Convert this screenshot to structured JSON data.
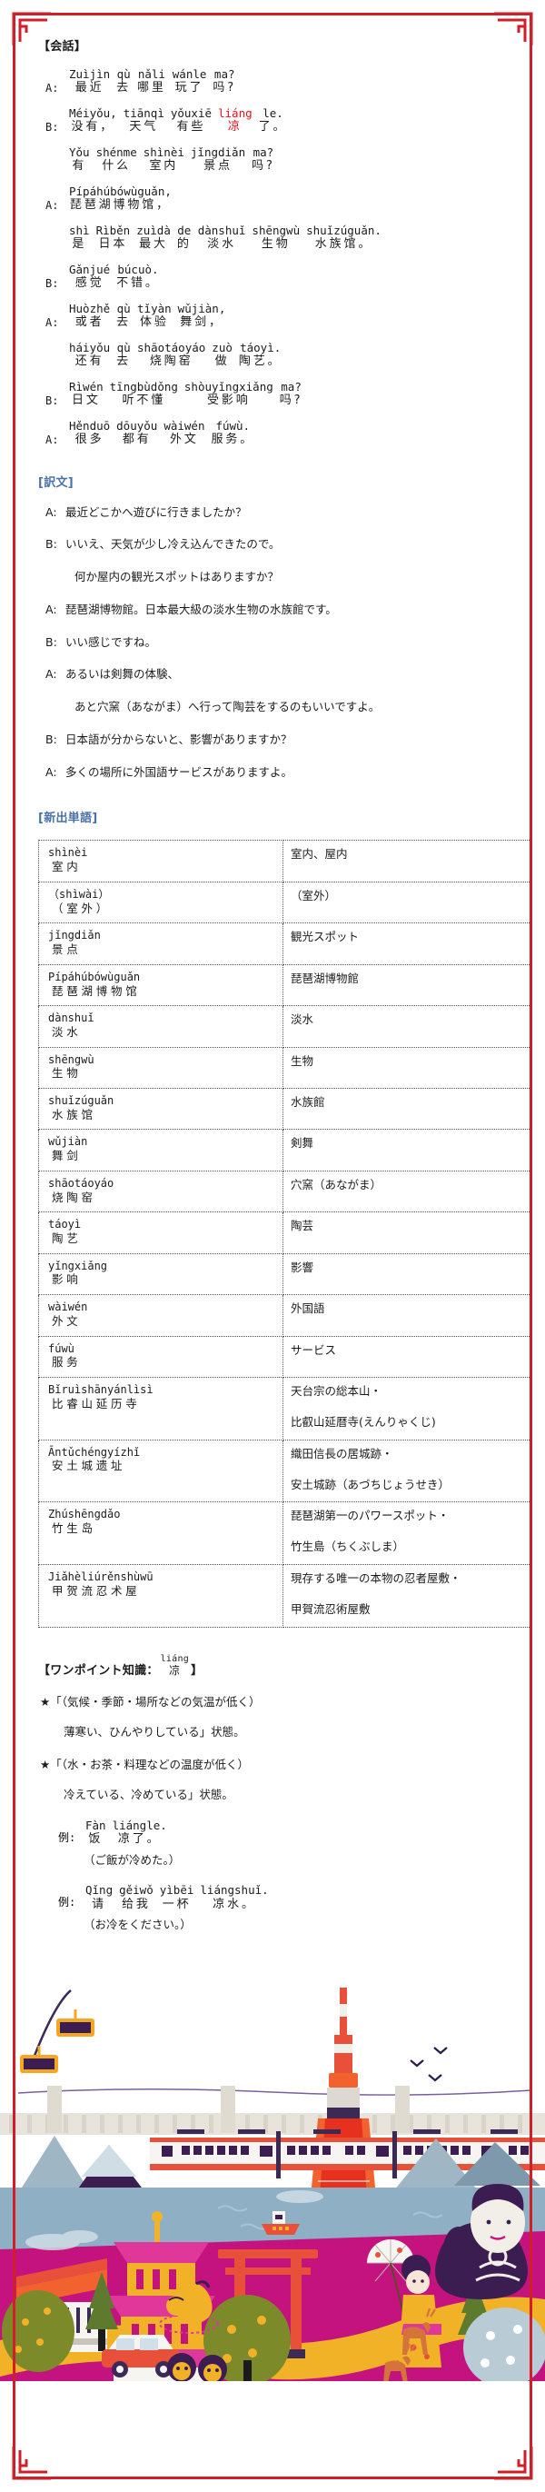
{
  "sections": {
    "dialogue_head": "【会話】",
    "translation_head": "[訳文]",
    "vocab_head": "[新出単語]",
    "onepoint_head_pre": "【ワンポイント知識：",
    "onepoint_head_post": "】",
    "onepoint_word_pinyin": "liáng",
    "onepoint_word_hanzi": "凉"
  },
  "colors": {
    "frame_red": "#d11f2a",
    "heading_blue": "#4a72a8",
    "highlight_red": "#e8101b",
    "text_black": "#1b1b1b"
  },
  "dialogue": [
    {
      "speaker": "A:",
      "tokens": [
        {
          "py": "Zuìjìn",
          "hz": "最近",
          "hl": false
        },
        {
          "py": "qù",
          "hz": "去",
          "hl": false
        },
        {
          "py": "nǎli",
          "hz": "哪里",
          "hl": false
        },
        {
          "py": "wánle",
          "hz": "玩了",
          "hl": false
        },
        {
          "py": "ma?",
          "hz": "吗?",
          "hl": false
        }
      ]
    },
    {
      "speaker": "B:",
      "tokens": [
        {
          "py": "Méiyǒu,",
          "hz": "没有，",
          "hl": false
        },
        {
          "py": "tiānqì",
          "hz": "天气",
          "hl": false
        },
        {
          "py": "yǒuxiē",
          "hz": "有些",
          "hl": false
        },
        {
          "py": "liáng",
          "hz": "凉",
          "hl": true
        },
        {
          "py": "le.",
          "hz": "了。",
          "hl": false
        }
      ]
    },
    {
      "speaker": "",
      "tokens": [
        {
          "py": "Yǒu",
          "hz": "有",
          "hl": false
        },
        {
          "py": "shénme",
          "hz": "什么",
          "hl": false
        },
        {
          "py": "shìnèi",
          "hz": "室内",
          "hl": false
        },
        {
          "py": "jǐngdiǎn",
          "hz": "景点",
          "hl": false
        },
        {
          "py": "ma?",
          "hz": "吗?",
          "hl": false
        }
      ]
    },
    {
      "speaker": "A:",
      "tokens": [
        {
          "py": "Pípáhúbówùguǎn,",
          "hz": "琵琶湖博物馆，",
          "hl": false
        }
      ]
    },
    {
      "speaker": "",
      "tokens": [
        {
          "py": "shì",
          "hz": "是",
          "hl": false
        },
        {
          "py": "Rìběn",
          "hz": "日本",
          "hl": false
        },
        {
          "py": "zuìdà",
          "hz": "最大",
          "hl": false
        },
        {
          "py": "de",
          "hz": "的",
          "hl": false
        },
        {
          "py": "dànshuǐ",
          "hz": "淡水",
          "hl": false
        },
        {
          "py": "shēngwù",
          "hz": "生物",
          "hl": false
        },
        {
          "py": "shuǐzúguǎn.",
          "hz": "水族馆。",
          "hl": false
        }
      ]
    },
    {
      "speaker": "B:",
      "tokens": [
        {
          "py": "Gǎnjué",
          "hz": "感觉",
          "hl": false
        },
        {
          "py": "búcuò.",
          "hz": "不错。",
          "hl": false
        }
      ]
    },
    {
      "speaker": "A:",
      "tokens": [
        {
          "py": "Huòzhě",
          "hz": "或者",
          "hl": false
        },
        {
          "py": "qù",
          "hz": "去",
          "hl": false
        },
        {
          "py": "tǐyàn",
          "hz": "体验",
          "hl": false
        },
        {
          "py": "wǔjiàn,",
          "hz": "舞剑，",
          "hl": false
        }
      ]
    },
    {
      "speaker": "",
      "tokens": [
        {
          "py": "háiyǒu",
          "hz": "还有",
          "hl": false
        },
        {
          "py": "qù",
          "hz": "去",
          "hl": false
        },
        {
          "py": "shāotáoyáo",
          "hz": "烧陶窑",
          "hl": false
        },
        {
          "py": "zuò",
          "hz": "做",
          "hl": false
        },
        {
          "py": "táoyì.",
          "hz": "陶艺。",
          "hl": false
        }
      ]
    },
    {
      "speaker": "B:",
      "tokens": [
        {
          "py": "Rìwén",
          "hz": "日文",
          "hl": false
        },
        {
          "py": "tīngbùdǒng",
          "hz": "听不懂",
          "hl": false
        },
        {
          "py": "shòuyǐngxiǎng",
          "hz": "受影响",
          "hl": false
        },
        {
          "py": "ma?",
          "hz": "吗?",
          "hl": false
        }
      ]
    },
    {
      "speaker": "A:",
      "tokens": [
        {
          "py": "Hěnduō",
          "hz": "很多",
          "hl": false
        },
        {
          "py": "dōuyǒu",
          "hz": "都有",
          "hl": false
        },
        {
          "py": "wàiwén",
          "hz": "外文",
          "hl": false
        },
        {
          "py": "fúwù.",
          "hz": "服务。",
          "hl": false
        }
      ]
    }
  ],
  "translation": [
    {
      "speaker": "A:",
      "text": "最近どこかへ遊びに行きましたか？",
      "indent": false
    },
    {
      "speaker": "B:",
      "text": "いいえ、天気が少し冷え込んできたので。",
      "indent": false
    },
    {
      "speaker": "",
      "text": "何か屋内の観光スポットはありますか？",
      "indent": true
    },
    {
      "speaker": "A:",
      "text": "琵琶湖博物館。日本最大級の淡水生物の水族館です。",
      "indent": false
    },
    {
      "speaker": "B:",
      "text": "いい感じですね。",
      "indent": false
    },
    {
      "speaker": "A:",
      "text": "あるいは剣舞の体験、",
      "indent": false
    },
    {
      "speaker": "",
      "text": "あと穴窯（あながま）へ行って陶芸をするのもいいですよ。",
      "indent": true
    },
    {
      "speaker": "B:",
      "text": "日本語が分からないと、影響がありますか？",
      "indent": false
    },
    {
      "speaker": "A:",
      "text": "多くの場所に外国語サービスがありますよ。",
      "indent": false
    }
  ],
  "vocab": [
    {
      "py": "shìnèi",
      "hz": "室内",
      "py2": "",
      "hz2": "",
      "meaning": [
        "室内、屋内"
      ]
    },
    {
      "py": "（shìwài）",
      "hz": "（室外）",
      "py2": "",
      "hz2": "",
      "meaning": [
        "（室外）"
      ],
      "paren": true
    },
    {
      "py": "jǐngdiǎn",
      "hz": "景点",
      "meaning": [
        "観光スポット"
      ]
    },
    {
      "py": "Pípáhúbówùguǎn",
      "hz": "琵琶湖博物馆",
      "meaning": [
        "琵琶湖博物館"
      ]
    },
    {
      "py": "dànshuǐ",
      "hz": "淡水",
      "meaning": [
        "淡水"
      ]
    },
    {
      "py": "shēngwù",
      "hz": "生物",
      "meaning": [
        "生物"
      ]
    },
    {
      "py": "shuǐzúguǎn",
      "hz": "水族馆",
      "meaning": [
        "水族館"
      ]
    },
    {
      "py": "wǔjiàn",
      "hz": "舞剑",
      "meaning": [
        "剣舞"
      ]
    },
    {
      "py": "shāotáoyáo",
      "hz": "烧陶窑",
      "meaning": [
        "穴窯（あながま）"
      ]
    },
    {
      "py": "táoyì",
      "hz": "陶艺",
      "meaning": [
        "陶芸"
      ]
    },
    {
      "py": "yǐngxiǎng",
      "hz": "影响",
      "meaning": [
        "影響"
      ]
    },
    {
      "py": "wàiwén",
      "hz": "外文",
      "meaning": [
        "外国語"
      ]
    },
    {
      "py": "fúwù",
      "hz": "服务",
      "meaning": [
        "サービス"
      ]
    },
    {
      "py": "Bǐruìshānyánlìsì",
      "hz": "比睿山延历寺",
      "meaning": [
        "天台宗の総本山・",
        "比叡山延暦寺(えんりゃくじ)"
      ]
    },
    {
      "py": "Āntǔchéngyízhǐ",
      "hz": "安土城遗址",
      "meaning": [
        "織田信長の居城跡・",
        "安土城跡（あづちじょうせき）"
      ]
    },
    {
      "py": "Zhúshēngdǎo",
      "hz": "竹生岛",
      "meaning": [
        "琵琶湖第一のパワースポット・",
        "竹生島（ちくぶしま）"
      ]
    },
    {
      "py": "Jiǎhèliúrěnshùwū",
      "hz": "甲贺流忍术屋",
      "meaning": [
        "現存する唯一の本物の忍者屋敷・",
        "甲賀流忍術屋敷"
      ]
    }
  ],
  "onepoint": {
    "star1": "★「（気候・季節・場所などの気温が低く）",
    "star1_sub": "薄寒い、ひんやりしている」状態。",
    "star2": "★「（水・お茶・料理などの温度が低く）",
    "star2_sub": "冷えている、冷めている」状態。",
    "examples": [
      {
        "label": "例:",
        "tokens": [
          {
            "py": "Fàn",
            "hz": "饭"
          },
          {
            "py": "liángle.",
            "hz": "凉了。"
          }
        ],
        "jp": "（ご飯が冷めた。）"
      },
      {
        "label": "例:",
        "tokens": [
          {
            "py": "Qǐng",
            "hz": "请"
          },
          {
            "py": "gěiwǒ",
            "hz": "给我"
          },
          {
            "py": "yìbēi",
            "hz": "一杯"
          },
          {
            "py": "liángshuǐ.",
            "hz": "凉水。"
          }
        ],
        "jp": "（お冷をください。）"
      }
    ]
  },
  "illustration": {
    "name": "japan-travel-scene",
    "elements": [
      "cable-cars",
      "tokyo-tower",
      "train",
      "pagoda",
      "torii-gate",
      "buddha-statue",
      "kimono-woman",
      "deer",
      "monkeys",
      "penguin",
      "mountains",
      "boat",
      "car",
      "trees"
    ]
  }
}
